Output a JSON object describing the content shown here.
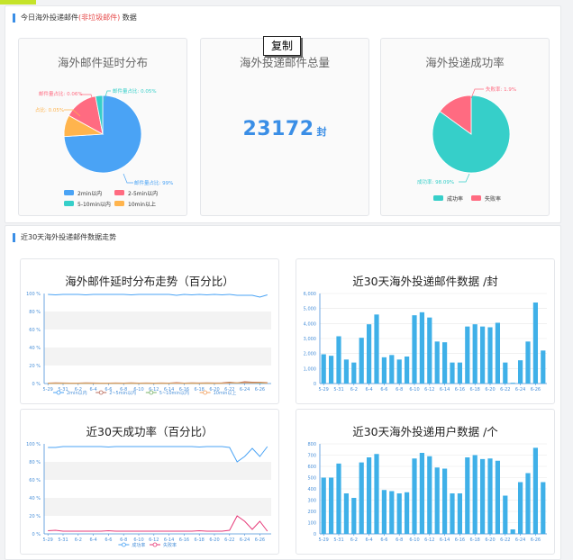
{
  "panel_top": {
    "title_prefix": "今日海外投递邮件",
    "title_highlight": "(非垃圾邮件)",
    "title_suffix": " 数据"
  },
  "panel_bottom": {
    "title": "近30天海外投递邮件数据走势"
  },
  "card_delay": {
    "title": "海外邮件延时分布",
    "labels": {
      "pie_2": "邮件量占比: 0.06%",
      "pie_3": "邮件量占比: 0.05%",
      "pie_4": "占比: 0.05%",
      "pie_1": "邮件量占比: 99%"
    },
    "legend": [
      "2min以内",
      "2-5min以内",
      "5-10min以内",
      "10min以上"
    ]
  },
  "card_total": {
    "title": "海外投递邮件总量",
    "value": "23172",
    "unit": "封"
  },
  "card_success": {
    "title": "海外投递成功率",
    "label_fail": "失败率: 1.9%",
    "label_success": "成功率: 98.09%",
    "legend": [
      "成功率",
      "失败率"
    ]
  },
  "copy_label": "复制",
  "colors": {
    "blue": "#4aa3f5",
    "pink": "#ff6b81",
    "teal": "#36cfc9",
    "orange": "#ffb44d",
    "green": "#7ab36a",
    "olive": "#b7a66b"
  },
  "chart_data": [
    {
      "type": "line",
      "title": "海外邮件延时分布走势（百分比）",
      "x": [
        "5-29",
        "5-30",
        "5-31",
        "6-1",
        "6-2",
        "6-3",
        "6-4",
        "6-5",
        "6-6",
        "6-7",
        "6-8",
        "6-9",
        "6-10",
        "6-11",
        "6-12",
        "6-13",
        "6-14",
        "6-15",
        "6-16",
        "6-17",
        "6-18",
        "6-19",
        "6-20",
        "6-21",
        "6-22",
        "6-23",
        "6-24",
        "6-25",
        "6-26",
        "6-27"
      ],
      "xticks": [
        "5-29",
        "5-31",
        "6-2",
        "6-4",
        "6-6",
        "6-8",
        "6-10",
        "6-12",
        "6-14",
        "6-16",
        "6-18",
        "6-20",
        "6-22",
        "6-24",
        "6-26"
      ],
      "yticks": [
        "100 %",
        "80 %",
        "60 %",
        "40 %",
        "20 %",
        "0 %"
      ],
      "ylim": [
        0,
        100
      ],
      "series": [
        {
          "name": "2min以内",
          "values": [
            99,
            98.5,
            99,
            99,
            99,
            98.5,
            99,
            99,
            99,
            99,
            99,
            98.5,
            99,
            99,
            99,
            99,
            99,
            98,
            99,
            98.5,
            99,
            98.5,
            99,
            98.5,
            99,
            98,
            98,
            98,
            96,
            98.5
          ]
        },
        {
          "name": "2~5min以内",
          "values": [
            0.5,
            0.8,
            0.6,
            0.5,
            0.5,
            0.8,
            0.6,
            0.5,
            0.5,
            0.6,
            0.5,
            0.8,
            0.5,
            0.6,
            0.5,
            0.6,
            0.5,
            1,
            0.5,
            0.8,
            0.6,
            0.8,
            0.6,
            0.8,
            1.5,
            0.8,
            2,
            1.5,
            1.5,
            1
          ]
        },
        {
          "name": "5~10min以内",
          "values": [
            0.3,
            0.3,
            0.4,
            0.3,
            0.3,
            0.4,
            0.3,
            0.3,
            0.3,
            0.3,
            0.3,
            0.4,
            0.3,
            0.3,
            0.3,
            0.3,
            0.3,
            0.5,
            0.3,
            0.4,
            0.3,
            0.4,
            0.3,
            0.4,
            0.8,
            0.5,
            1,
            0.8,
            0.8,
            0.5
          ]
        },
        {
          "name": "10min以上",
          "values": [
            0.2,
            0.2,
            0.3,
            0.2,
            0.2,
            0.3,
            0.2,
            0.2,
            0.2,
            0.2,
            0.2,
            0.3,
            0.2,
            0.2,
            0.2,
            0.2,
            0.2,
            0.5,
            0.2,
            0.3,
            0.2,
            0.3,
            0.2,
            0.3,
            0.7,
            0.7,
            1,
            0.7,
            1.2,
            0.5
          ]
        }
      ]
    },
    {
      "type": "bar",
      "title": "近30天海外投递邮件数据 /封",
      "categories": [
        "5-29",
        "5-30",
        "5-31",
        "6-1",
        "6-2",
        "6-3",
        "6-4",
        "6-5",
        "6-6",
        "6-7",
        "6-8",
        "6-9",
        "6-10",
        "6-11",
        "6-12",
        "6-13",
        "6-14",
        "6-15",
        "6-16",
        "6-17",
        "6-18",
        "6-19",
        "6-20",
        "6-21",
        "6-22",
        "6-23",
        "6-24",
        "6-25",
        "6-26",
        "6-27"
      ],
      "xticks": [
        "5-29",
        "5-31",
        "6-2",
        "6-4",
        "6-6",
        "6-8",
        "6-10",
        "6-12",
        "6-14",
        "6-16",
        "6-18",
        "6-20",
        "6-22",
        "6-24",
        "6-26"
      ],
      "yticks": [
        "6,000",
        "5,000",
        "4,000",
        "3,000",
        "2,000",
        "1,000",
        "0"
      ],
      "ylim": [
        0,
        6000
      ],
      "values": [
        1950,
        1850,
        3150,
        1600,
        1400,
        3050,
        3950,
        4600,
        1750,
        1900,
        1600,
        1800,
        4550,
        4750,
        4400,
        2800,
        2750,
        1400,
        1400,
        3800,
        3950,
        3800,
        3750,
        4050,
        1400,
        50,
        1550,
        2800,
        5400,
        2200
      ]
    },
    {
      "type": "line",
      "title": "近30天成功率（百分比）",
      "x": [
        "5-29",
        "5-30",
        "5-31",
        "6-1",
        "6-2",
        "6-3",
        "6-4",
        "6-5",
        "6-6",
        "6-7",
        "6-8",
        "6-9",
        "6-10",
        "6-11",
        "6-12",
        "6-13",
        "6-14",
        "6-15",
        "6-16",
        "6-17",
        "6-18",
        "6-19",
        "6-20",
        "6-21",
        "6-22",
        "6-23",
        "6-24",
        "6-25",
        "6-26",
        "6-27"
      ],
      "xticks": [
        "5-29",
        "5-31",
        "6-2",
        "6-4",
        "6-6",
        "6-8",
        "6-10",
        "6-12",
        "6-14",
        "6-16",
        "6-18",
        "6-20",
        "6-22",
        "6-24",
        "6-26"
      ],
      "yticks": [
        "100 %",
        "80 %",
        "60 %",
        "40 %",
        "20 %",
        "0 %"
      ],
      "ylim": [
        0,
        100
      ],
      "series": [
        {
          "name": "成功率",
          "values": [
            96,
            96,
            97,
            97,
            97,
            97,
            97,
            97,
            96.5,
            97,
            97,
            97,
            97,
            97,
            97,
            97,
            97,
            97,
            97,
            97,
            96.5,
            97,
            97,
            97,
            96,
            80,
            86,
            95,
            86,
            97
          ]
        },
        {
          "name": "失败率",
          "values": [
            3.5,
            4,
            3,
            3,
            3,
            3,
            3,
            3,
            3.5,
            3,
            3,
            3,
            3,
            3,
            3,
            3,
            3,
            3,
            3,
            3,
            3.5,
            3,
            3,
            3,
            4,
            20,
            14,
            5,
            14,
            3
          ]
        }
      ]
    },
    {
      "type": "bar",
      "title": "近30天海外投递用户数据 /个",
      "categories": [
        "5-29",
        "5-30",
        "5-31",
        "6-1",
        "6-2",
        "6-3",
        "6-4",
        "6-5",
        "6-6",
        "6-7",
        "6-8",
        "6-9",
        "6-10",
        "6-11",
        "6-12",
        "6-13",
        "6-14",
        "6-15",
        "6-16",
        "6-17",
        "6-18",
        "6-19",
        "6-20",
        "6-21",
        "6-22",
        "6-23",
        "6-24",
        "6-25",
        "6-26",
        "6-27"
      ],
      "xticks": [
        "5-29",
        "5-31",
        "6-2",
        "6-4",
        "6-6",
        "6-8",
        "6-10",
        "6-12",
        "6-14",
        "6-16",
        "6-18",
        "6-20",
        "6-22",
        "6-24",
        "6-26"
      ],
      "yticks": [
        "800",
        "700",
        "600",
        "500",
        "400",
        "300",
        "200",
        "100",
        "0"
      ],
      "ylim": [
        0,
        800
      ],
      "values": [
        500,
        500,
        625,
        360,
        320,
        635,
        680,
        710,
        390,
        380,
        360,
        370,
        670,
        720,
        690,
        590,
        580,
        360,
        360,
        680,
        700,
        665,
        670,
        650,
        340,
        40,
        460,
        540,
        765,
        460
      ]
    }
  ]
}
